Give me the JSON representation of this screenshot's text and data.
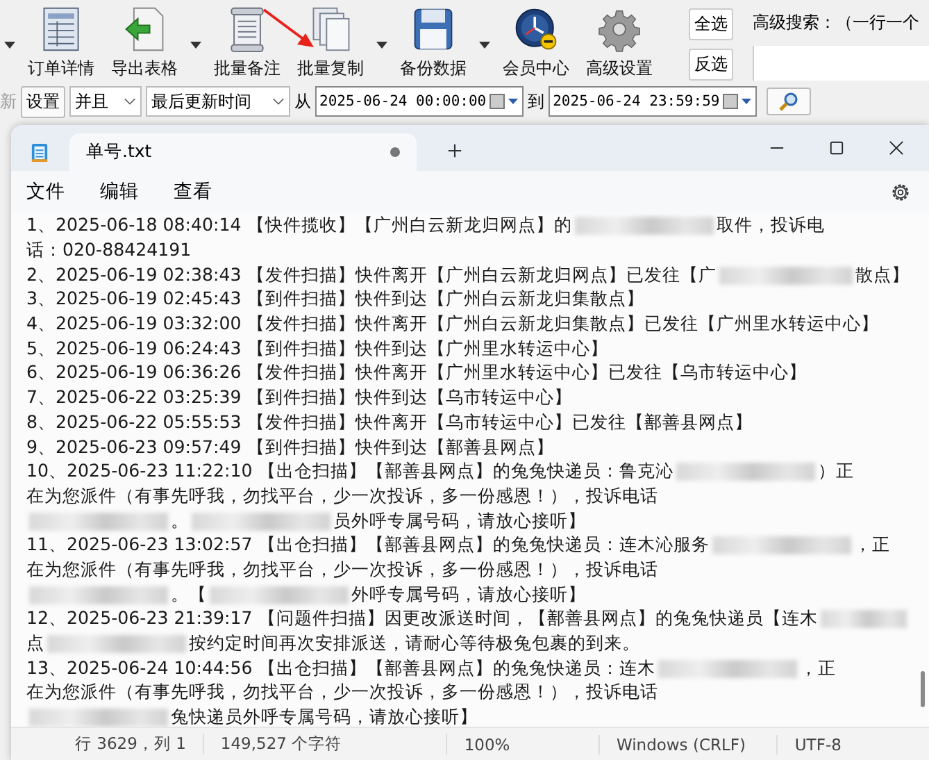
{
  "toolbar": {
    "clipped_dropdown": true,
    "items": [
      {
        "label": "订单详情",
        "dropdown": false
      },
      {
        "label": "导出表格",
        "dropdown": true
      },
      {
        "label": "批量备注",
        "dropdown": false
      },
      {
        "label": "批量复制",
        "dropdown": true
      },
      {
        "label": "备份数据",
        "dropdown": true
      },
      {
        "label": "会员中心",
        "dropdown": false
      },
      {
        "label": "高级设置",
        "dropdown": false
      }
    ],
    "select_buttons": [
      "全选",
      "反选"
    ],
    "advanced_search": {
      "label": "高级搜索：（一行一个"
    }
  },
  "filter_bar": {
    "clipped_label": "新",
    "settings_button": "设置",
    "logic": "并且",
    "field": "最后更新时间",
    "from_label": "从",
    "from": "2025-06-24 00:00:00",
    "to_label": "到",
    "to": "2025-06-24 23:59:59"
  },
  "notepad": {
    "tab": {
      "title": "单号.txt",
      "unsaved": true
    },
    "menu": [
      "文件",
      "编辑",
      "查看"
    ],
    "entries": [
      [
        [
          "1、2025-06-18 08:40:14 【快件揽收】【广州白云新龙归网点】的",
          {
            "kind": "redacted"
          },
          "取件，投诉电"
        ],
        [
          "话：020-88424191"
        ]
      ],
      [
        [
          "2、2025-06-19 02:38:43 【发件扫描】快件离开【广州白云新龙归网点】已发往【广",
          {
            "kind": "redacted"
          },
          "散点】"
        ]
      ],
      [
        [
          "3、2025-06-19 02:45:43 【到件扫描】快件到达【广州白云新龙归集散点】"
        ]
      ],
      [
        [
          "4、2025-06-19 03:32:00 【发件扫描】快件离开【广州白云新龙归集散点】已发往【广州里水转运中心】"
        ]
      ],
      [
        [
          "5、2025-06-19 06:24:43 【到件扫描】快件到达【广州里水转运中心】"
        ]
      ],
      [
        [
          "6、2025-06-19 06:36:26 【发件扫描】快件离开【广州里水转运中心】已发往【乌市转运中心】"
        ]
      ],
      [
        [
          "7、2025-06-22 03:25:39 【到件扫描】快件到达【乌市转运中心】"
        ]
      ],
      [
        [
          "8、2025-06-22 05:55:53 【发件扫描】快件离开【乌市转运中心】已发往【鄯善县网点】"
        ]
      ],
      [
        [
          "9、2025-06-23 09:57:49 【到件扫描】快件到达【鄯善县网点】"
        ]
      ],
      [
        [
          "10、2025-06-23 11:22:10 【出仓扫描】【鄯善县网点】的兔兔快递员：鲁克沁",
          {
            "kind": "redacted"
          },
          "）正"
        ],
        [
          "在为您派件（有事先呼我，勿找平台，少一次投诉，多一份感恩！），投诉电话"
        ],
        [
          {
            "kind": "redacted"
          },
          "。",
          {
            "kind": "redacted"
          },
          "员外呼专属号码，请放心接听】"
        ]
      ],
      [
        [
          "11、2025-06-23 13:02:57 【出仓扫描】【鄯善县网点】的兔兔快递员：连木沁服务",
          {
            "kind": "redacted"
          },
          "，正"
        ],
        [
          "在为您派件（有事先呼我，勿找平台，少一次投诉，多一份感恩！），投诉电话"
        ],
        [
          {
            "kind": "redacted"
          },
          "。【",
          {
            "kind": "redacted"
          },
          "外呼专属号码，请放心接听】"
        ]
      ],
      [
        [
          "12、2025-06-23 21:39:17 【问题件扫描】因更改派送时间，【鄯善县网点】的兔兔快递员【连木",
          {
            "kind": "redacted"
          }
        ],
        [
          "点",
          {
            "kind": "redacted"
          },
          "按约定时间再次安排派送，请耐心等待极兔包裹的到来。"
        ]
      ],
      [
        [
          "13、2025-06-24 10:44:56 【出仓扫描】【鄯善县网点】的兔兔快递员：连木",
          {
            "kind": "redacted"
          },
          "，正"
        ],
        [
          "在为您派件（有事先呼我，勿找平台，少一次投诉，多一份感恩！），投诉电话"
        ],
        [
          {
            "kind": "redacted"
          },
          "兔快递员外呼专属号码，请放心接听】"
        ]
      ]
    ],
    "status": [
      "行 3629，列 1",
      "149,527 个字符",
      "100%",
      "Windows (CRLF)",
      "UTF-8"
    ]
  }
}
